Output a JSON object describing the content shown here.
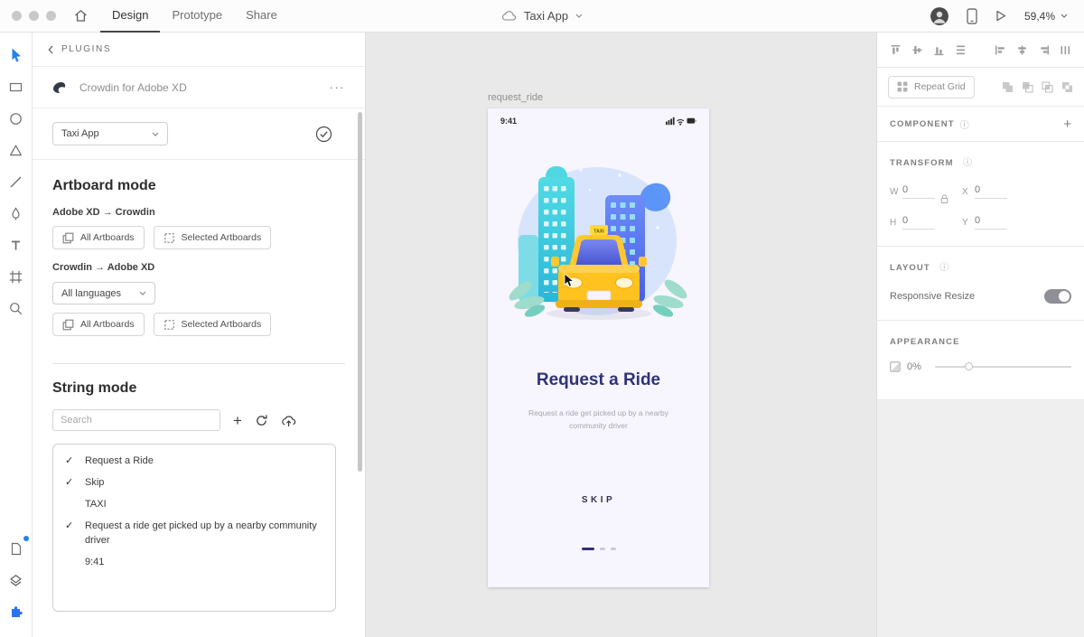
{
  "icons": {
    "overflow_menu": "···",
    "plus": "+",
    "info": "ⓘ"
  },
  "topbar": {
    "tabs": [
      {
        "label": "Design"
      },
      {
        "label": "Prototype"
      },
      {
        "label": "Share"
      }
    ],
    "document_title": "Taxi App",
    "zoom": "59,4%"
  },
  "plugin_panel": {
    "header": "PLUGINS",
    "title": "Crowdin for Adobe XD",
    "project_select": "Taxi App",
    "artboard_mode": {
      "heading": "Artboard mode",
      "direction_to_crowdin": "Adobe XD → Crowdin",
      "direction_to_xd": "Crowdin → Adobe XD",
      "all_artboards": "All Artboards",
      "selected_artboards": "Selected Artboards",
      "languages_select": "All languages"
    },
    "string_mode": {
      "heading": "String mode",
      "search_placeholder": "Search",
      "strings": [
        {
          "check": "✓",
          "text": "Request a Ride"
        },
        {
          "check": "✓",
          "text": "Skip"
        },
        {
          "check": "",
          "text": "TAXI"
        },
        {
          "check": "✓",
          "text": "Request a ride get picked up by a nearby community driver"
        },
        {
          "check": "",
          "text": "9:41"
        }
      ]
    }
  },
  "canvas": {
    "artboard_label": "request_ride",
    "screen": {
      "time": "9:41",
      "taxi_sign": "TAXI",
      "title": "Request a Ride",
      "subtitle": "Request a ride get picked up by a nearby community driver",
      "skip": "SKIP"
    }
  },
  "inspector": {
    "repeat_grid": "Repeat Grid",
    "component_label": "COMPONENT",
    "transform": {
      "label": "TRANSFORM",
      "w_label": "W",
      "x_label": "X",
      "h_label": "H",
      "y_label": "Y",
      "w": "0",
      "x": "0",
      "h": "0",
      "y": "0"
    },
    "layout": {
      "label": "LAYOUT",
      "responsive_resize": "Responsive Resize"
    },
    "appearance": {
      "label": "APPEARANCE",
      "opacity": "0%"
    }
  }
}
